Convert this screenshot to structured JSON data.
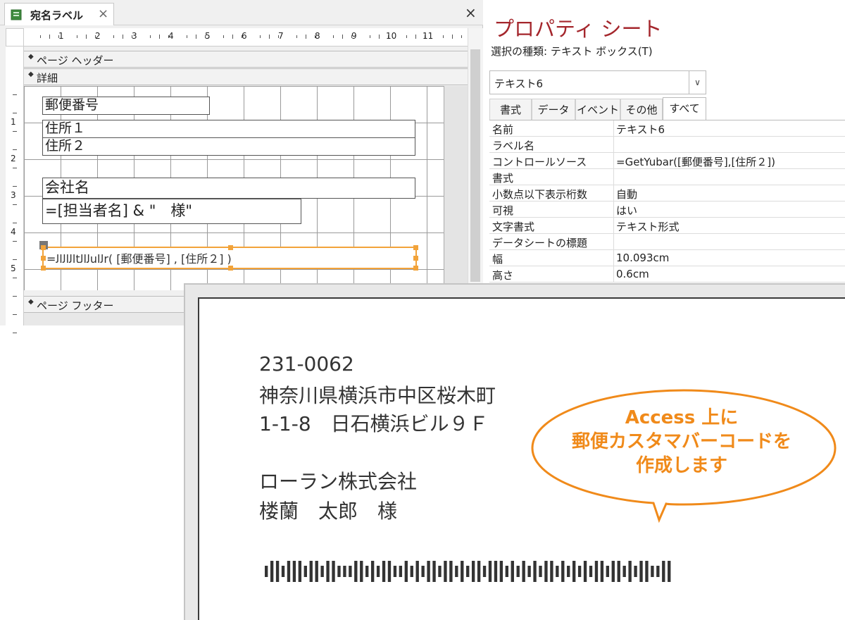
{
  "design": {
    "tab_title": "宛名ラベル",
    "tab_close": "×",
    "window_close": "×",
    "ruler_h": [
      "1",
      "2",
      "3",
      "4",
      "5",
      "6",
      "7",
      "8",
      "9",
      "10",
      "11"
    ],
    "ruler_v": [
      "1",
      "2",
      "3",
      "4",
      "5"
    ],
    "sections": {
      "page_header": "ページ ヘッダー",
      "detail": "詳細",
      "page_footer": "ページ フッター"
    },
    "controls": {
      "zip": "郵便番号",
      "addr1": "住所１",
      "addr2": "住所２",
      "company": "会社名",
      "person": "=[担当者名] & \"　様\"",
      "barcode": "=ﺍﻟﺍﻟﺍﻟtﻟﺍﻟuﻟﺍr( [郵便番号] , [住所２] )"
    }
  },
  "properties": {
    "title": "プロパティ シート",
    "selection_type": "選択の種類:  テキスト ボックス(T)",
    "selected_control": "テキスト6",
    "tabs": [
      "書式",
      "データ",
      "イベント",
      "その他",
      "すべて"
    ],
    "active_tab": "すべて",
    "rows": [
      {
        "name": "名前",
        "value": "テキスト6"
      },
      {
        "name": "ラベル名",
        "value": ""
      },
      {
        "name": "コントロールソース",
        "value": "=GetYubar([郵便番号],[住所２])"
      },
      {
        "name": "書式",
        "value": ""
      },
      {
        "name": "小数点以下表示桁数",
        "value": "自動"
      },
      {
        "name": "可視",
        "value": "はい"
      },
      {
        "name": "文字書式",
        "value": "テキスト形式"
      },
      {
        "name": "データシートの標題",
        "value": ""
      },
      {
        "name": "幅",
        "value": "10.093cm"
      },
      {
        "name": "高さ",
        "value": "0.6cm"
      }
    ]
  },
  "preview": {
    "zip": "231-0062",
    "address1": "神奈川県横浜市中区桜木町",
    "address2": "1-1-8　日石横浜ビル９Ｆ",
    "company": "ローラン株式会社",
    "person": "楼蘭　太郎　様",
    "barcode_pattern": "2112111211211222112121122121211211212112111212121211212121211211212112211",
    "bar_color": "#333333"
  },
  "callout": {
    "lines": [
      "Access 上に",
      "郵便カスタマバーコードを",
      "作成します"
    ],
    "text_color": "#f08a1a",
    "border_color": "#f08a1a"
  }
}
